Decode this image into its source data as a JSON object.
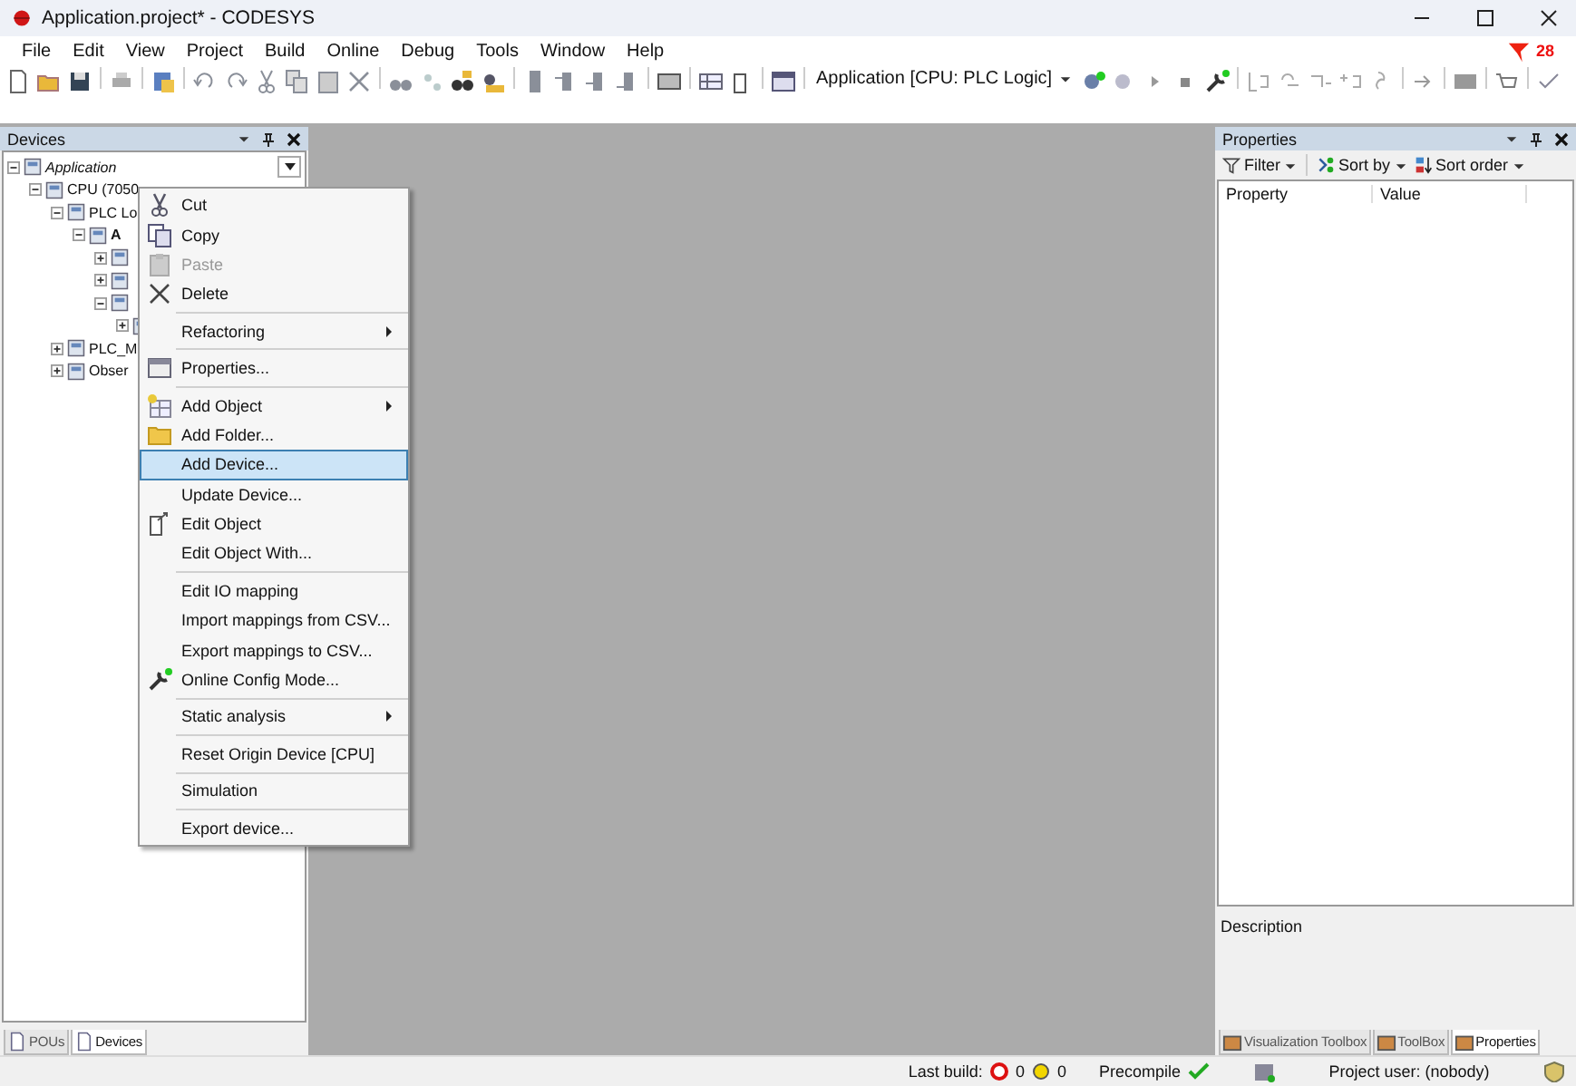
{
  "window": {
    "title": "Application.project* - CODESYS"
  },
  "menu_bar": [
    "File",
    "Edit",
    "View",
    "Project",
    "Build",
    "Online",
    "Debug",
    "Tools",
    "Window",
    "Help"
  ],
  "message_count": "28",
  "toolbar": {
    "active_application": "Application [CPU: PLC Logic]"
  },
  "devices_panel": {
    "title": "Devices",
    "tree": [
      {
        "label": "Application",
        "italic": true,
        "expanded": true,
        "children": [
          {
            "label": "CPU (7050",
            "expanded": true,
            "children": [
              {
                "label": "PLC Lo",
                "expanded": true,
                "children": [
                  {
                    "label": "A",
                    "bold": true,
                    "expanded": true,
                    "children": [
                      {
                        "expanded": false
                      },
                      {
                        "expanded": false
                      },
                      {
                        "expanded": true,
                        "children": [
                          {
                            "expanded": false
                          }
                        ]
                      }
                    ]
                  }
                ]
              },
              {
                "label": "PLC_M",
                "expanded": false
              },
              {
                "label": "Obser",
                "expanded": false
              }
            ]
          }
        ]
      }
    ],
    "tabs": [
      {
        "label": "POUs",
        "selected": false
      },
      {
        "label": "Devices",
        "selected": true
      }
    ]
  },
  "context_menu": [
    {
      "kind": "item",
      "label": "Cut",
      "disabled": false,
      "selected": false,
      "submenu": false
    },
    {
      "kind": "item",
      "label": "Copy",
      "disabled": false,
      "selected": false,
      "submenu": false
    },
    {
      "kind": "item",
      "label": "Paste",
      "disabled": true,
      "selected": false,
      "submenu": false
    },
    {
      "kind": "item",
      "label": "Delete",
      "disabled": false,
      "selected": false,
      "submenu": false
    },
    {
      "kind": "separator"
    },
    {
      "kind": "item",
      "label": "Refactoring",
      "disabled": false,
      "selected": false,
      "submenu": true
    },
    {
      "kind": "separator"
    },
    {
      "kind": "item",
      "label": "Properties...",
      "disabled": false,
      "selected": false,
      "submenu": false
    },
    {
      "kind": "separator"
    },
    {
      "kind": "item",
      "label": "Add Object",
      "disabled": false,
      "selected": false,
      "submenu": true
    },
    {
      "kind": "item",
      "label": "Add Folder...",
      "disabled": false,
      "selected": false,
      "submenu": false
    },
    {
      "kind": "item",
      "label": "Add Device...",
      "disabled": false,
      "selected": true,
      "submenu": false
    },
    {
      "kind": "item",
      "label": "Update Device...",
      "disabled": false,
      "selected": false,
      "submenu": false
    },
    {
      "kind": "item",
      "label": "Edit Object",
      "disabled": false,
      "selected": false,
      "submenu": false
    },
    {
      "kind": "item",
      "label": "Edit Object With...",
      "disabled": false,
      "selected": false,
      "submenu": false
    },
    {
      "kind": "separator"
    },
    {
      "kind": "item",
      "label": "Edit IO mapping",
      "disabled": false,
      "selected": false,
      "submenu": false
    },
    {
      "kind": "item",
      "label": "Import mappings from CSV...",
      "disabled": false,
      "selected": false,
      "submenu": false
    },
    {
      "kind": "item",
      "label": "Export mappings to CSV...",
      "disabled": false,
      "selected": false,
      "submenu": false
    },
    {
      "kind": "item",
      "label": "Online Config Mode...",
      "disabled": false,
      "selected": false,
      "submenu": false
    },
    {
      "kind": "separator"
    },
    {
      "kind": "item",
      "label": "Static analysis",
      "disabled": false,
      "selected": false,
      "submenu": true
    },
    {
      "kind": "separator"
    },
    {
      "kind": "item",
      "label": "Reset Origin Device [CPU]",
      "disabled": false,
      "selected": false,
      "submenu": false
    },
    {
      "kind": "separator"
    },
    {
      "kind": "item",
      "label": "Simulation",
      "disabled": false,
      "selected": false,
      "submenu": false
    },
    {
      "kind": "separator"
    },
    {
      "kind": "item",
      "label": "Export device...",
      "disabled": false,
      "selected": false,
      "submenu": false
    }
  ],
  "properties_panel": {
    "title": "Properties",
    "toolbar": [
      "Filter",
      "Sort by",
      "Sort order"
    ],
    "columns": [
      "Property",
      "Value"
    ],
    "description_label": "Description",
    "tabs": [
      {
        "label": "Visualization Toolbox",
        "selected": false
      },
      {
        "label": "ToolBox",
        "selected": false
      },
      {
        "label": "Properties",
        "selected": true
      }
    ]
  },
  "status_bar": {
    "last_build_label": "Last build:",
    "errors": "0",
    "warnings": "0",
    "precompile": "Precompile",
    "project_user": "Project user: (nobody)"
  }
}
